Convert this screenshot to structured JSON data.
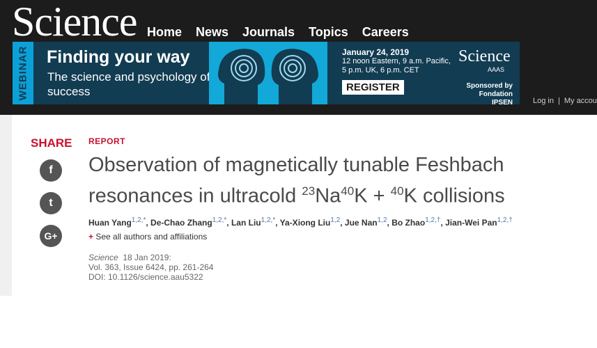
{
  "header": {
    "logo": "Science",
    "nav": [
      "Home",
      "News",
      "Journals",
      "Topics",
      "Careers"
    ],
    "account": [
      "Log in",
      "My accoun"
    ]
  },
  "banner": {
    "tag": "WEBINAR",
    "headline": "Finding your way",
    "subheadline": "The science and psychology of success",
    "date": "January 24, 2019",
    "time": "12 noon Eastern, 9 a.m. Pacific, 5 p.m. UK, 6 p.m. CET",
    "cta": "REGISTER",
    "sponsor_logo": "Science",
    "sponsor_aaas": "AAAS",
    "sponsor_text": "Sponsored by Fondation IPSEN",
    "accent_color": "#0ba1d8",
    "background_color": "#123c52"
  },
  "share": {
    "label": "SHARE",
    "buttons": [
      {
        "icon": "facebook-icon",
        "glyph": "f"
      },
      {
        "icon": "twitter-icon",
        "glyph": "t"
      },
      {
        "icon": "google-plus-icon",
        "glyph": "G+"
      }
    ]
  },
  "article": {
    "type": "REPORT",
    "title_parts": [
      {
        "text": "Observation of magnetically tunable Feshbach resonances in ultracold ",
        "sup": false
      },
      {
        "text": "23",
        "sup": true
      },
      {
        "text": "Na",
        "sup": false
      },
      {
        "text": "40",
        "sup": true
      },
      {
        "text": "K + ",
        "sup": false
      },
      {
        "text": "40",
        "sup": true
      },
      {
        "text": "K collisions",
        "sup": false
      }
    ],
    "authors": [
      {
        "name": "Huan Yang",
        "aff": "1,2,*"
      },
      {
        "name": "De-Chao Zhang",
        "aff": "1,2,*"
      },
      {
        "name": "Lan Liu",
        "aff": "1,2,*"
      },
      {
        "name": "Ya-Xiong Liu",
        "aff": "1,2"
      },
      {
        "name": "Jue Nan",
        "aff": "1,2"
      },
      {
        "name": "Bo Zhao",
        "aff": "1,2,†"
      },
      {
        "name": "Jian-Wei Pan",
        "aff": "1,2,†"
      }
    ],
    "see_all": "See all authors and affiliations",
    "journal": "Science",
    "date": "18 Jan 2019:",
    "volume": "Vol. 363, Issue 6424, pp. 261-264",
    "doi": "DOI: 10.1126/science.aau5322",
    "brand_red": "#c8102e"
  }
}
